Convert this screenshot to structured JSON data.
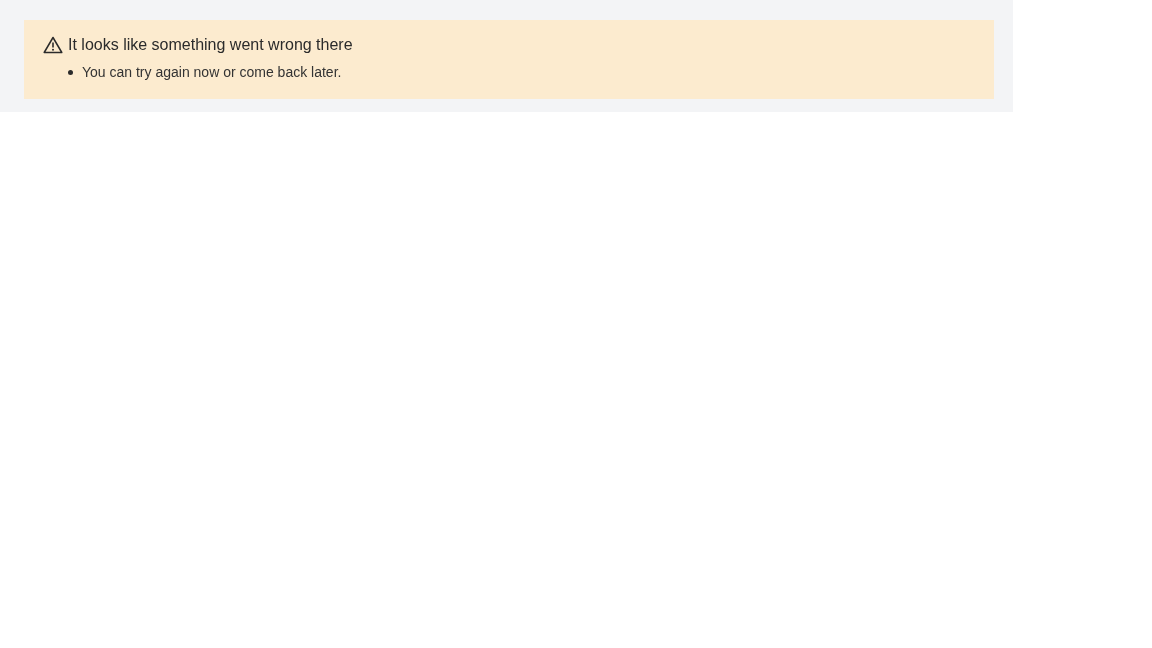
{
  "alert": {
    "kind": "warning",
    "title": "It looks like something went wrong there",
    "items": [
      "You can try again now or come back later."
    ]
  }
}
